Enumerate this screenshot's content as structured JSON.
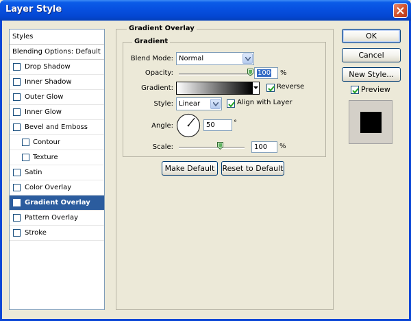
{
  "window": {
    "title": "Layer Style"
  },
  "styles": {
    "header": "Styles",
    "blending": "Blending Options: Default",
    "items": [
      {
        "label": "Drop Shadow",
        "checked": false,
        "indent": false,
        "selected": false
      },
      {
        "label": "Inner Shadow",
        "checked": false,
        "indent": false,
        "selected": false
      },
      {
        "label": "Outer Glow",
        "checked": false,
        "indent": false,
        "selected": false
      },
      {
        "label": "Inner Glow",
        "checked": false,
        "indent": false,
        "selected": false
      },
      {
        "label": "Bevel and Emboss",
        "checked": false,
        "indent": false,
        "selected": false
      },
      {
        "label": "Contour",
        "checked": false,
        "indent": true,
        "selected": false
      },
      {
        "label": "Texture",
        "checked": false,
        "indent": true,
        "selected": false
      },
      {
        "label": "Satin",
        "checked": false,
        "indent": false,
        "selected": false
      },
      {
        "label": "Color Overlay",
        "checked": false,
        "indent": false,
        "selected": false
      },
      {
        "label": "Gradient Overlay",
        "checked": true,
        "indent": false,
        "selected": true
      },
      {
        "label": "Pattern Overlay",
        "checked": false,
        "indent": false,
        "selected": false
      },
      {
        "label": "Stroke",
        "checked": false,
        "indent": false,
        "selected": false
      }
    ]
  },
  "gradient_overlay": {
    "title": "Gradient Overlay",
    "group_title": "Gradient",
    "blend_mode_label": "Blend Mode:",
    "blend_mode_value": "Normal",
    "opacity_label": "Opacity:",
    "opacity_value": "100",
    "opacity_level": 1.0,
    "percent": "%",
    "gradient_label": "Gradient:",
    "gradient_from": "#ffffff",
    "gradient_to": "#000000",
    "reverse_label": "Reverse",
    "reverse_checked": true,
    "style_label": "Style:",
    "style_value": "Linear",
    "align_label": "Align with Layer",
    "align_checked": true,
    "angle_label": "Angle:",
    "angle_value": "50",
    "degree": "°",
    "scale_label": "Scale:",
    "scale_value": "100",
    "scale_level": 0.625,
    "make_default": "Make Default",
    "reset_default": "Reset to Default"
  },
  "actions": {
    "ok": "OK",
    "cancel": "Cancel",
    "new_style": "New Style...",
    "preview_label": "Preview",
    "preview_checked": true
  },
  "colors": {
    "selection": "#2b5c9e",
    "titlebar": "#0750e0"
  }
}
